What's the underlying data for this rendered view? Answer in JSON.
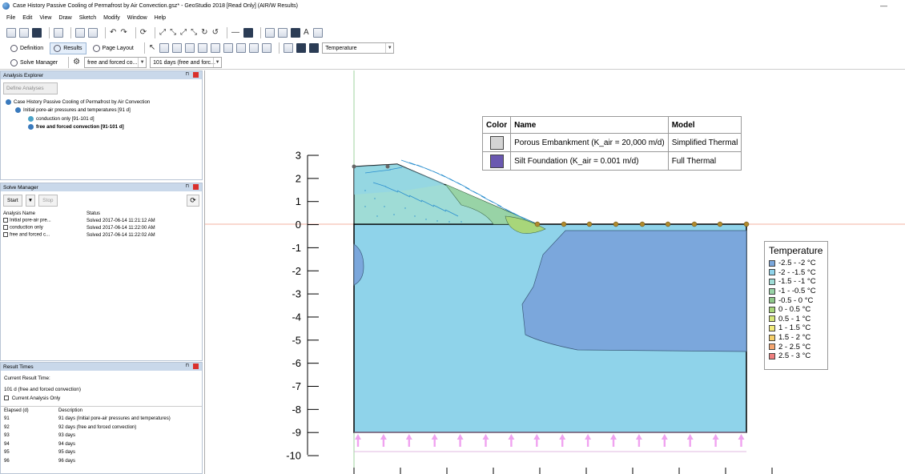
{
  "window": {
    "title": "Case History Passive Cooling of Permafrost by Air Convection.gsz* - GeoStudio 2018 [Read Only] (AIR/W Results)",
    "minimize_glyph": "—"
  },
  "menu": [
    "File",
    "Edit",
    "View",
    "Draw",
    "Sketch",
    "Modify",
    "Window",
    "Help"
  ],
  "toolbar2": {
    "definition_label": "Definition",
    "results_label": "Results",
    "page_layout_label": "Page Layout",
    "contour_select_value": "Temperature"
  },
  "toolbar3": {
    "solve_manager_label": "Solve Manager",
    "analysis_select_value": "free and forced co...",
    "time_select_value": "101 days (free and forc..."
  },
  "analysis_explorer": {
    "title": "Analysis Explorer",
    "define_button": "Define Analyses",
    "tree": [
      {
        "label": "Case History Passive Cooling of Permafrost by Air Convection",
        "bold": false
      },
      {
        "label": "Initial pore-air pressures and temperatures [91 d]",
        "bold": false
      },
      {
        "label": "conduction only [91-101 d]",
        "bold": false
      },
      {
        "label": "free and forced convection [91-101 d]",
        "bold": true
      }
    ]
  },
  "solve_manager": {
    "title": "Solve Manager",
    "start_label": "Start",
    "stop_label": "Stop",
    "columns": [
      "Analysis Name",
      "Status"
    ],
    "rows": [
      {
        "name": "Initial pore-air pre...",
        "status": "Solved 2017-06-14 11:21:12 AM"
      },
      {
        "name": "conduction only",
        "status": "Solved 2017-06-14 11:22:00 AM"
      },
      {
        "name": "free and forced c...",
        "status": "Solved 2017-06-14 11:22:02 AM"
      }
    ]
  },
  "result_times": {
    "title": "Result Times",
    "current_label": "Current Result Time:",
    "current_value": "101 d (free and forced convection)",
    "current_only_label": "Current Analysis Only",
    "columns": [
      "Elapsed (d)",
      "Description"
    ],
    "rows": [
      {
        "elapsed": "91",
        "desc": "91 days (Initial pore-air pressures and temperatures)"
      },
      {
        "elapsed": "92",
        "desc": "92 days (free and forced convection)"
      },
      {
        "elapsed": "93",
        "desc": "93 days"
      },
      {
        "elapsed": "94",
        "desc": "94 days"
      },
      {
        "elapsed": "95",
        "desc": "95 days"
      },
      {
        "elapsed": "96",
        "desc": "96 days"
      }
    ]
  },
  "y_axis": {
    "ticks": [
      "3",
      "2",
      "1",
      "0",
      "-1",
      "-2",
      "-3",
      "-4",
      "-5",
      "-6",
      "-7",
      "-8",
      "-9",
      "-10"
    ]
  },
  "materials": {
    "columns": [
      "Color",
      "Name",
      "Model"
    ],
    "rows": [
      {
        "color": "#d4d4d4",
        "name": "Porous Embankment (K_air = 20,000 m/d)",
        "model": "Simplified Thermal"
      },
      {
        "color": "#6a58b0",
        "name": "Silt Foundation (K_air = 0.001 m/d)",
        "model": "Full Thermal"
      }
    ]
  },
  "legend": {
    "title": "Temperature",
    "items": [
      {
        "label": "-2.5 - -2 °C",
        "color": "#7ba7dc"
      },
      {
        "label": "-2 - -1.5 °C",
        "color": "#8fd3ea"
      },
      {
        "label": "-1.5 - -1 °C",
        "color": "#9fdcd6"
      },
      {
        "label": "-1 - -0.5 °C",
        "color": "#98d3a6"
      },
      {
        "label": "-0.5 - 0 °C",
        "color": "#8fc88a"
      },
      {
        "label": "0 - 0.5 °C",
        "color": "#a8d67a"
      },
      {
        "label": "0.5 - 1 °C",
        "color": "#d6e77a"
      },
      {
        "label": "1 - 1.5 °C",
        "color": "#f3ec7c"
      },
      {
        "label": "1.5 - 2 °C",
        "color": "#f6cf6a"
      },
      {
        "label": "2 - 2.5 °C",
        "color": "#f4a570"
      },
      {
        "label": "2.5 - 3 °C",
        "color": "#ef7f7f"
      }
    ]
  },
  "colors": {
    "panel_header": "#c9d8ea",
    "foundation_fill": "#8fd3ea",
    "cold_zone_fill": "#7ba7dc",
    "flux_arrow": "#f0a3f0",
    "node_marker": "#b08a2c"
  }
}
